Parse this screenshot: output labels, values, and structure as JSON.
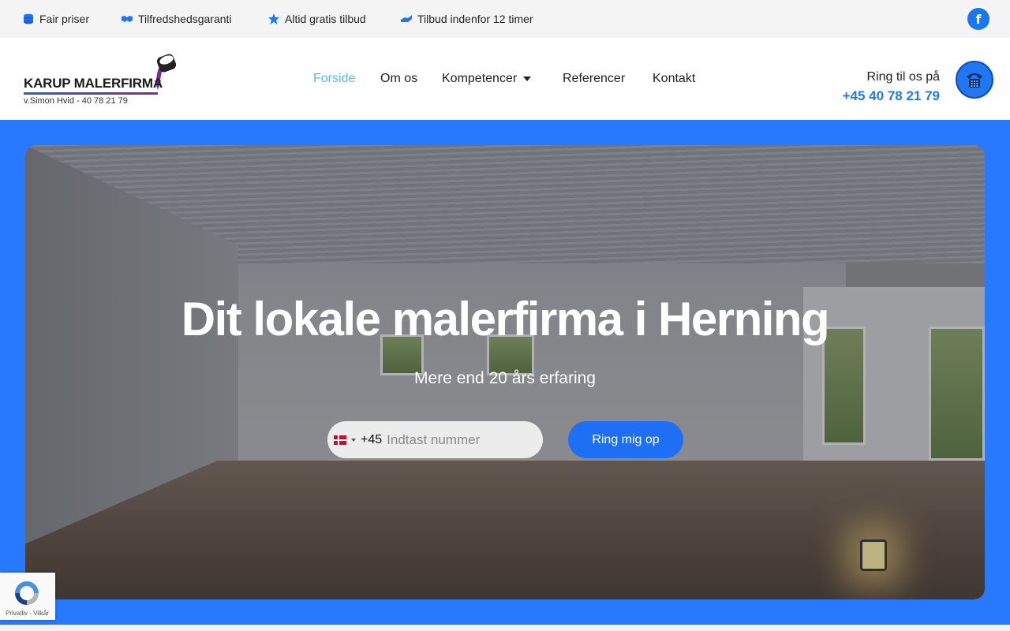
{
  "topbar": {
    "usps": [
      {
        "label": "Fair priser",
        "icon": "coins-icon"
      },
      {
        "label": "Tilfredshedsgaranti",
        "icon": "handshake-icon"
      },
      {
        "label": "Altid gratis tilbud",
        "icon": "star-icon"
      },
      {
        "label": "Tilbud indenfor 12 timer",
        "icon": "hands-icon"
      }
    ],
    "facebook_icon": "facebook-icon"
  },
  "logo": {
    "title": "KARUP MALERFIRMA",
    "subtitle": "v.Simon Hvid - 40 78 21 79"
  },
  "nav": {
    "items": [
      {
        "label": "Forside",
        "active": true
      },
      {
        "label": "Om os"
      },
      {
        "label": "Kompetencer",
        "has_dropdown": true
      },
      {
        "label": "Referencer"
      },
      {
        "label": "Kontakt"
      }
    ]
  },
  "call": {
    "label": "Ring til os på",
    "number": "+45 40 78 21 79"
  },
  "hero": {
    "title": "Dit lokale malerfirma i Herning",
    "subtitle": "Mere end 20 års erfaring",
    "dial_code": "+45",
    "phone_placeholder": "Indtast nummer",
    "button_label": "Ring mig op"
  },
  "recaptcha": {
    "text": "Privatliv - Vilkår"
  },
  "colors": {
    "accent_blue": "#2176f2",
    "hero_bg": "#2979ff",
    "active_nav": "#4ec0e4"
  }
}
